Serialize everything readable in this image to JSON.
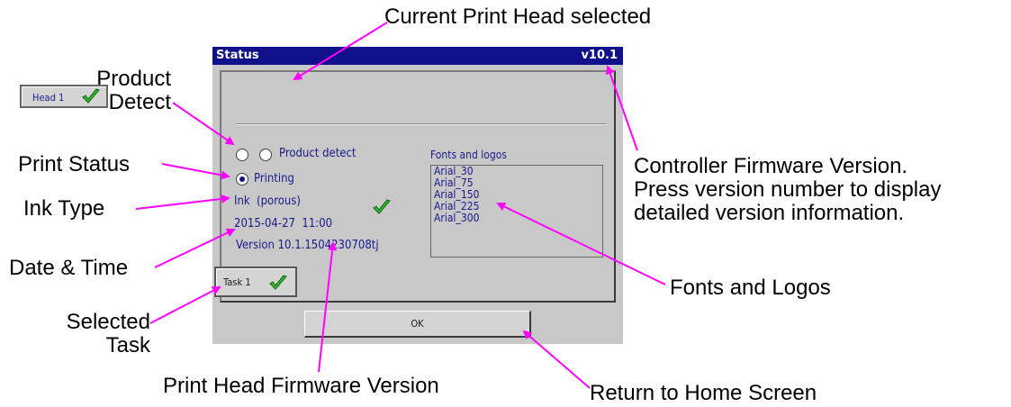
{
  "window": {
    "title": "Status",
    "version": "v10.1"
  },
  "head_tab": {
    "label": "Head 1",
    "status_icon": "check-icon"
  },
  "status": {
    "product_detect_label": "Product detect",
    "printing_label": "Printing",
    "ink_type": "Ink  (porous)",
    "date_time": "2015-04-27  11:00",
    "head_version": "Version 10.1.1504230708tj"
  },
  "fonts": {
    "header": "Fonts and logos",
    "items": [
      "Arial_30",
      "Arial_75",
      "Arial_150",
      "Arial_225",
      "Arial_300"
    ]
  },
  "task_button": {
    "label": "Task 1",
    "status_icon": "check-icon"
  },
  "ok_button": {
    "label": "OK"
  },
  "callouts": {
    "current_head": "Current Print Head selected",
    "product_detect": "Product\nDetect",
    "print_status": "Print Status",
    "ink_type": "Ink Type",
    "date_time": "Date & Time",
    "selected_task": "Selected\nTask",
    "head_firmware": "Print Head Firmware Version",
    "return_home": "Return to Home Screen",
    "fonts_logos": "Fonts and Logos",
    "controller_fw": "Controller Firmware Version.\nPress version number to display\ndetailed version information."
  },
  "colors": {
    "titlebar": "#10108a",
    "dialog_bg": "#c8c8c8",
    "arrow": "#ff00ff",
    "check": "#2fbf2f"
  }
}
